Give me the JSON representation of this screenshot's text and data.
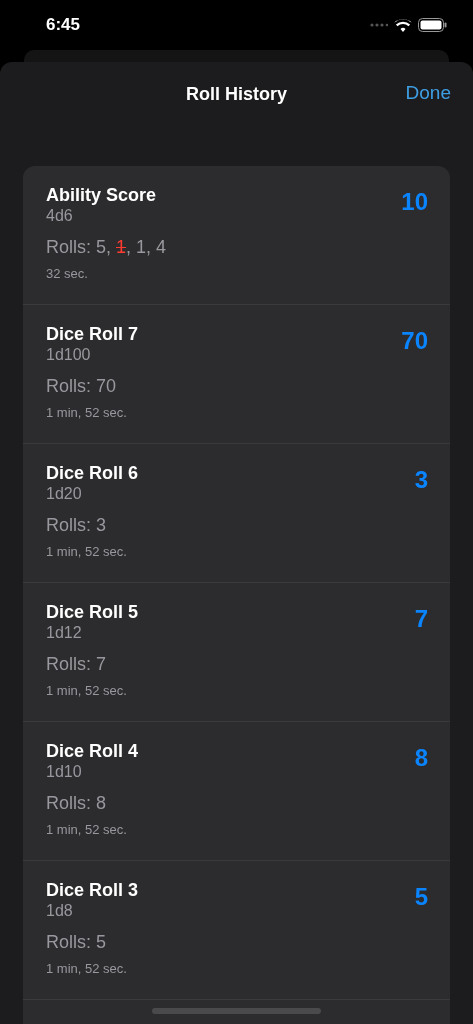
{
  "status_bar": {
    "time": "6:45"
  },
  "nav": {
    "title": "Roll History",
    "done": "Done"
  },
  "rolls": [
    {
      "name": "Ability Score",
      "dice": "4d6",
      "parts": [
        {
          "text": "Rolls: 5, ",
          "dropped": false
        },
        {
          "text": "1",
          "dropped": true
        },
        {
          "text": ", 1, 4",
          "dropped": false
        }
      ],
      "time": "32 sec.",
      "total": "10"
    },
    {
      "name": "Dice Roll 7",
      "dice": "1d100",
      "parts": [
        {
          "text": "Rolls: 70",
          "dropped": false
        }
      ],
      "time": "1 min, 52 sec.",
      "total": "70"
    },
    {
      "name": "Dice Roll 6",
      "dice": "1d20",
      "parts": [
        {
          "text": "Rolls: 3",
          "dropped": false
        }
      ],
      "time": "1 min, 52 sec.",
      "total": "3"
    },
    {
      "name": "Dice Roll 5",
      "dice": "1d12",
      "parts": [
        {
          "text": "Rolls: 7",
          "dropped": false
        }
      ],
      "time": "1 min, 52 sec.",
      "total": "7"
    },
    {
      "name": "Dice Roll 4",
      "dice": "1d10",
      "parts": [
        {
          "text": "Rolls: 8",
          "dropped": false
        }
      ],
      "time": "1 min, 52 sec.",
      "total": "8"
    },
    {
      "name": "Dice Roll 3",
      "dice": "1d8",
      "parts": [
        {
          "text": "Rolls: 5",
          "dropped": false
        }
      ],
      "time": "1 min, 52 sec.",
      "total": "5"
    }
  ]
}
